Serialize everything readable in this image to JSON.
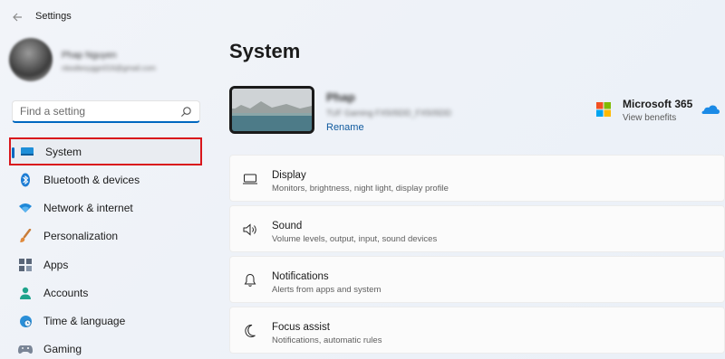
{
  "window": {
    "title": "Settings"
  },
  "user": {
    "name": "Phap Nguyen",
    "email": "nbodtesyggn016@gmail.com"
  },
  "search": {
    "placeholder": "Find a setting"
  },
  "sidebar": {
    "items": [
      {
        "label": "System",
        "icon": "monitor-icon",
        "active": true
      },
      {
        "label": "Bluetooth & devices",
        "icon": "bluetooth-icon"
      },
      {
        "label": "Network & internet",
        "icon": "wifi-icon"
      },
      {
        "label": "Personalization",
        "icon": "brush-icon"
      },
      {
        "label": "Apps",
        "icon": "apps-icon"
      },
      {
        "label": "Accounts",
        "icon": "person-icon"
      },
      {
        "label": "Time & language",
        "icon": "globe-clock-icon"
      },
      {
        "label": "Gaming",
        "icon": "gamepad-icon"
      }
    ]
  },
  "main": {
    "title": "System",
    "device": {
      "name": "Phap",
      "model": "TUF Gaming FX505DD_FX505DD",
      "rename_label": "Rename"
    },
    "microsoft365": {
      "title": "Microsoft 365",
      "subtitle": "View benefits"
    },
    "cards": [
      {
        "title": "Display",
        "desc": "Monitors, brightness, night light, display profile",
        "icon": "display-icon"
      },
      {
        "title": "Sound",
        "desc": "Volume levels, output, input, sound devices",
        "icon": "speaker-icon"
      },
      {
        "title": "Notifications",
        "desc": "Alerts from apps and system",
        "icon": "bell-icon"
      },
      {
        "title": "Focus assist",
        "desc": "Notifications, automatic rules",
        "icon": "moon-icon"
      }
    ]
  },
  "colors": {
    "accent": "#0067c0",
    "highlight_border": "#d9161c"
  }
}
